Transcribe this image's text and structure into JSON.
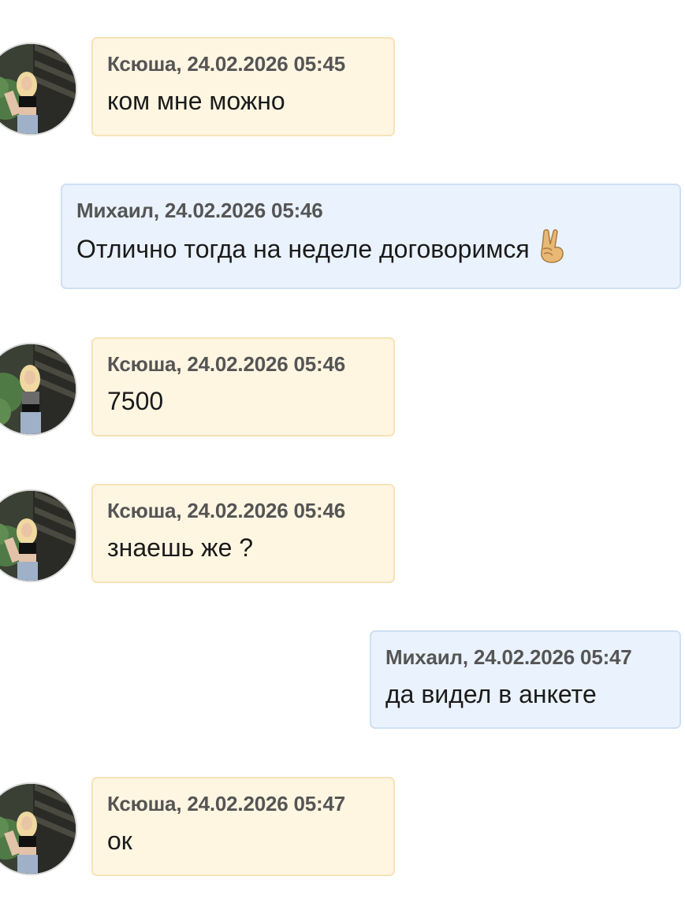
{
  "chat": {
    "messages": [
      {
        "sender": "Ксюша",
        "meta": "Ксюша, 24.02.2026 05:45",
        "text": "ком мне можно",
        "direction": "incoming"
      },
      {
        "sender": "Михаил",
        "meta": "Михаил, 24.02.2026 05:46",
        "text": "Отлично тогда на неделе договоримся",
        "emoji": "victory-hand-icon",
        "direction": "outgoing"
      },
      {
        "sender": "Ксюша",
        "meta": "Ксюша, 24.02.2026 05:46",
        "text": "7500",
        "direction": "incoming"
      },
      {
        "sender": "Ксюша",
        "meta": "Ксюша, 24.02.2026 05:46",
        "text": "знаешь же ?",
        "direction": "incoming"
      },
      {
        "sender": "Михаил",
        "meta": "Михаил, 24.02.2026 05:47",
        "text": "да видел в анкете",
        "direction": "outgoing"
      },
      {
        "sender": "Ксюша",
        "meta": "Ксюша, 24.02.2026 05:47",
        "text": "ок",
        "direction": "incoming"
      }
    ]
  },
  "colors": {
    "incoming_bubble": "#fff6e2",
    "incoming_border": "#f7e3b6",
    "outgoing_bubble": "#eaf2fd",
    "outgoing_border": "#cfe0f4",
    "meta_text": "#555555",
    "body_text": "#1b1b1b"
  }
}
